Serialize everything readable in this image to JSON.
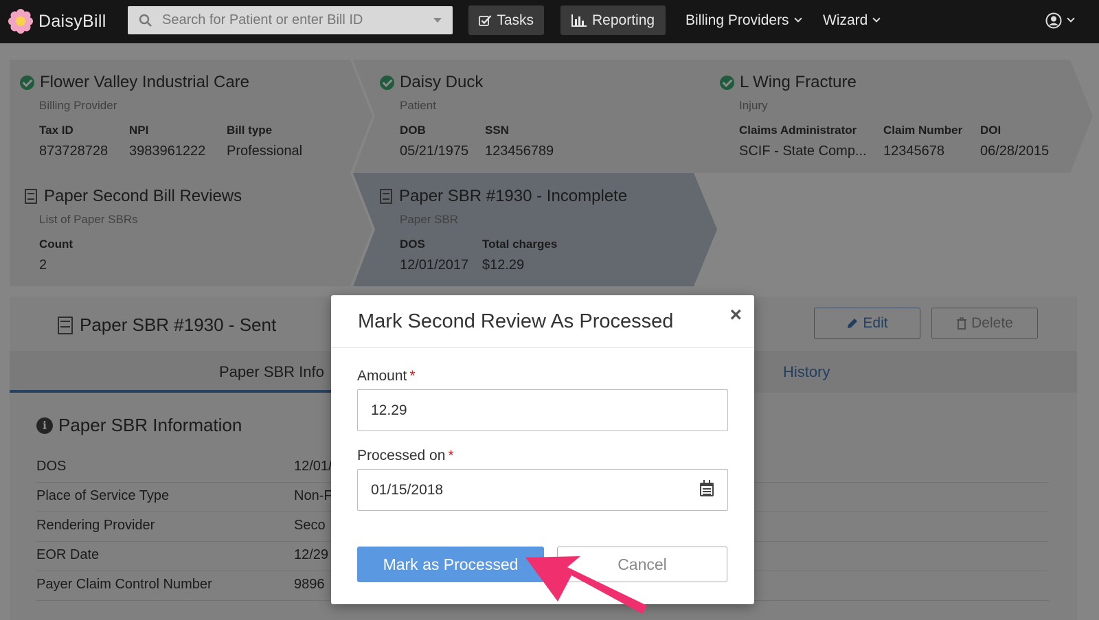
{
  "nav": {
    "brand": "DaisyBill",
    "search_placeholder": "Search for Patient or enter Bill ID",
    "tasks": "Tasks",
    "reporting": "Reporting",
    "billing_providers": "Billing Providers",
    "wizard": "Wizard"
  },
  "breadcrumbs": {
    "provider": {
      "title": "Flower Valley Industrial Care",
      "subtitle": "Billing Provider",
      "fields": [
        {
          "label": "Tax ID",
          "value": "873728728"
        },
        {
          "label": "NPI",
          "value": "3983961222"
        },
        {
          "label": "Bill type",
          "value": "Professional"
        }
      ]
    },
    "patient": {
      "title": "Daisy Duck",
      "subtitle": "Patient",
      "fields": [
        {
          "label": "DOB",
          "value": "05/21/1975"
        },
        {
          "label": "SSN",
          "value": "123456789"
        }
      ]
    },
    "injury": {
      "title": "L Wing Fracture",
      "subtitle": "Injury",
      "fields": [
        {
          "label": "Claims Administrator",
          "value": "SCIF - State Comp..."
        },
        {
          "label": "Claim Number",
          "value": "12345678"
        },
        {
          "label": "DOI",
          "value": "06/28/2015"
        }
      ]
    },
    "sbr_list": {
      "title": "Paper Second Bill Reviews",
      "subtitle": "List of Paper SBRs",
      "fields": [
        {
          "label": "Count",
          "value": "2"
        }
      ]
    },
    "sbr_current": {
      "title": "Paper SBR #1930 - Incomplete",
      "subtitle": "Paper SBR",
      "fields": [
        {
          "label": "DOS",
          "value": "12/01/2017"
        },
        {
          "label": "Total charges",
          "value": "$12.29"
        }
      ]
    }
  },
  "panel": {
    "title": "Paper SBR #1930 - Sent",
    "edit": "Edit",
    "delete": "Delete",
    "tabs": [
      "Paper SBR Info",
      "History"
    ],
    "section_title": "Paper SBR Information",
    "rows": [
      {
        "label": "DOS",
        "value": "12/01/"
      },
      {
        "label": "Place of Service Type",
        "value": "Non-F"
      },
      {
        "label": "Rendering Provider",
        "value": "Seco"
      },
      {
        "label": "EOR Date",
        "value": "12/29"
      },
      {
        "label": "Payer Claim Control Number",
        "value": "9896"
      }
    ]
  },
  "modal": {
    "title": "Mark Second Review As Processed",
    "close": "×",
    "amount_label": "Amount",
    "amount_value": "12.29",
    "processed_label": "Processed on",
    "processed_value": "01/15/2018",
    "required_mark": "*",
    "submit": "Mark as Processed",
    "cancel": "Cancel"
  },
  "colors": {
    "nav_bg": "#161616",
    "primary_button": "#5b98e2",
    "check_green": "#3aa76d",
    "annotation_arrow": "#f0306e"
  }
}
